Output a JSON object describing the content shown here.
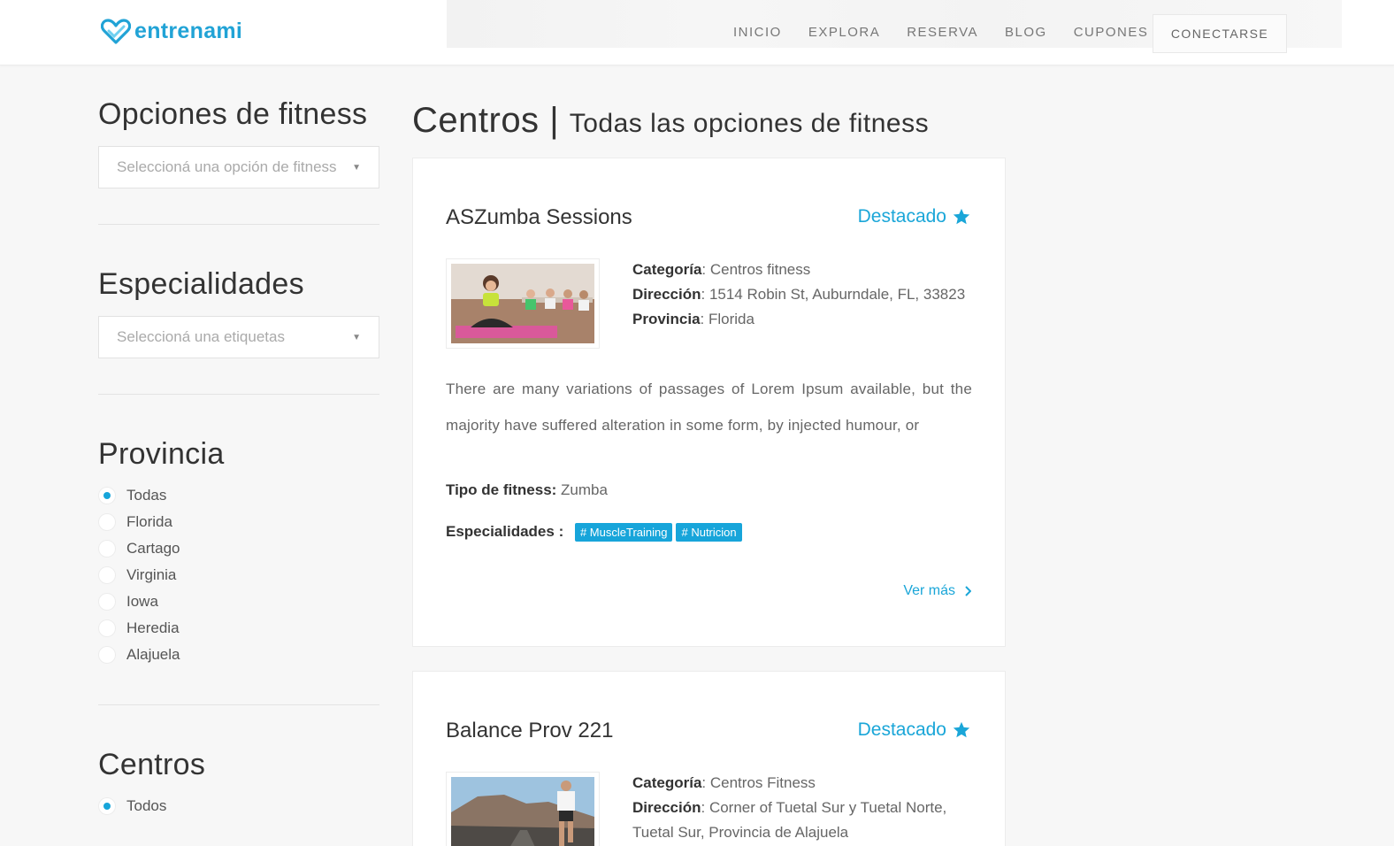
{
  "brand": {
    "name": "entrenami",
    "accent": "#1aa6d8"
  },
  "nav": {
    "items": [
      "INICIO",
      "EXPLORA",
      "RESERVA",
      "BLOG",
      "CUPONES"
    ],
    "connect": "CONECTARSE"
  },
  "sidebar": {
    "fitness": {
      "title": "Opciones de fitness",
      "placeholder": "Seleccioná una opción de fitness"
    },
    "specialties": {
      "title": "Especialidades",
      "placeholder": "Seleccioná una etiquetas"
    },
    "province": {
      "title": "Provincia",
      "options": [
        "Todas",
        "Florida",
        "Cartago",
        "Virginia",
        "Iowa",
        "Heredia",
        "Alajuela"
      ],
      "selected": "Todas"
    },
    "centers": {
      "title": "Centros",
      "options": [
        "Todos"
      ],
      "selected": "Todos"
    }
  },
  "main": {
    "title": "Centros",
    "separator": "|",
    "subtitle": "Todas las opciones de fitness",
    "listings": [
      {
        "name": "ASZumba Sessions",
        "featured": "Destacado",
        "category_label": "Categoría",
        "category": "Centros fitness",
        "address_label": "Dirección",
        "address": "1514 Robin St, Auburndale, FL, 33823",
        "province_label": "Provincia",
        "province": "Florida",
        "description": "There are many variations of passages of Lorem Ipsum available, but the majority have suffered alteration in some form, by injected humour, or",
        "type_label": "Tipo de fitness:",
        "type": "Zumba",
        "specialties_label": "Especialidades :",
        "tags": [
          "# MuscleTraining",
          "# Nutricion"
        ],
        "more": "Ver más",
        "image": "yoga-class-photo"
      },
      {
        "name": "Balance Prov 221",
        "featured": "Destacado",
        "category_label": "Categoría",
        "category": "Centros Fitness",
        "address_label": "Dirección",
        "address": "Corner of Tuetal Sur y Tuetal Norte, Tuetal Sur, Provincia de Alajuela",
        "image": "runner-photo"
      }
    ]
  }
}
